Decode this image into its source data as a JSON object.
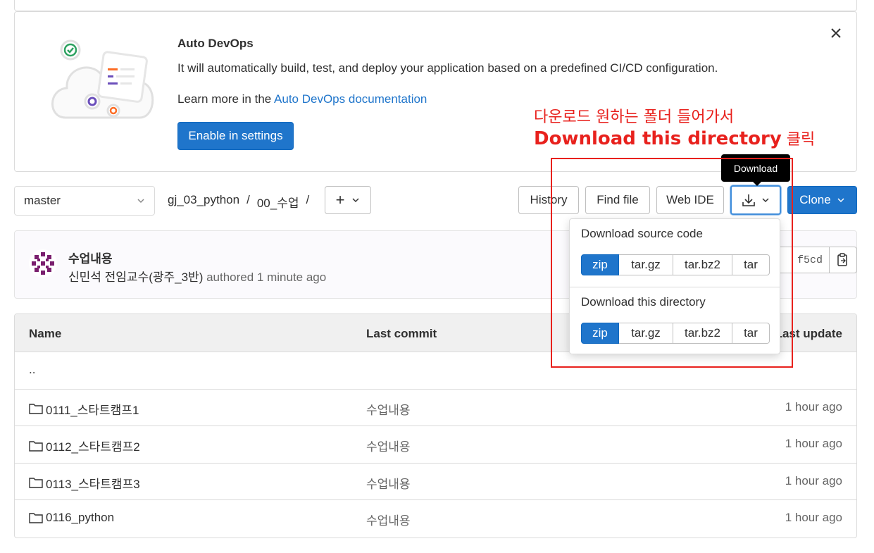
{
  "banner": {
    "title": "Auto DevOps",
    "description": "It will automatically build, test, and deploy your application based on a predefined CI/CD configuration.",
    "learn_prefix": "Learn more in the ",
    "learn_link": "Auto DevOps documentation",
    "enable_button": "Enable in settings",
    "close_icon": "×"
  },
  "annotation": {
    "line1": "다운로드 원하는 폴더 들어가서",
    "line2_bold": "Download this directory",
    "line2_suffix": " 클릭",
    "color": "#e8211d"
  },
  "toolbar": {
    "branch": "master",
    "breadcrumb": [
      "gj_03_python",
      "/",
      "00_수업",
      "/"
    ],
    "add_label": "+",
    "history": "History",
    "find_file": "Find file",
    "web_ide": "Web IDE",
    "clone": "Clone",
    "download_tooltip": "Download"
  },
  "commit": {
    "title": "수업내용",
    "author": "신민석 전임교수(광주_3반)",
    "meta_suffix": " authored 1 minute ago",
    "sha": "f5cd"
  },
  "download_menu": {
    "source_heading": "Download source code",
    "directory_heading": "Download this directory",
    "formats": [
      "zip",
      "tar.gz",
      "tar.bz2",
      "tar"
    ]
  },
  "table": {
    "headers": {
      "name": "Name",
      "last_commit": "Last commit",
      "last_update": "Last update"
    },
    "parent": "..",
    "rows": [
      {
        "name": "0111_스타트캠프1",
        "commit": "수업내용",
        "update": "1 hour ago"
      },
      {
        "name": "0112_스타트캠프2",
        "commit": "수업내용",
        "update": "1 hour ago"
      },
      {
        "name": "0113_스타트캠프3",
        "commit": "수업내용",
        "update": "1 hour ago"
      },
      {
        "name": "0116_python",
        "commit": "수업내용",
        "update": "1 hour ago"
      }
    ]
  },
  "colors": {
    "primary": "#1f75cb",
    "annotation": "#e8211d"
  }
}
